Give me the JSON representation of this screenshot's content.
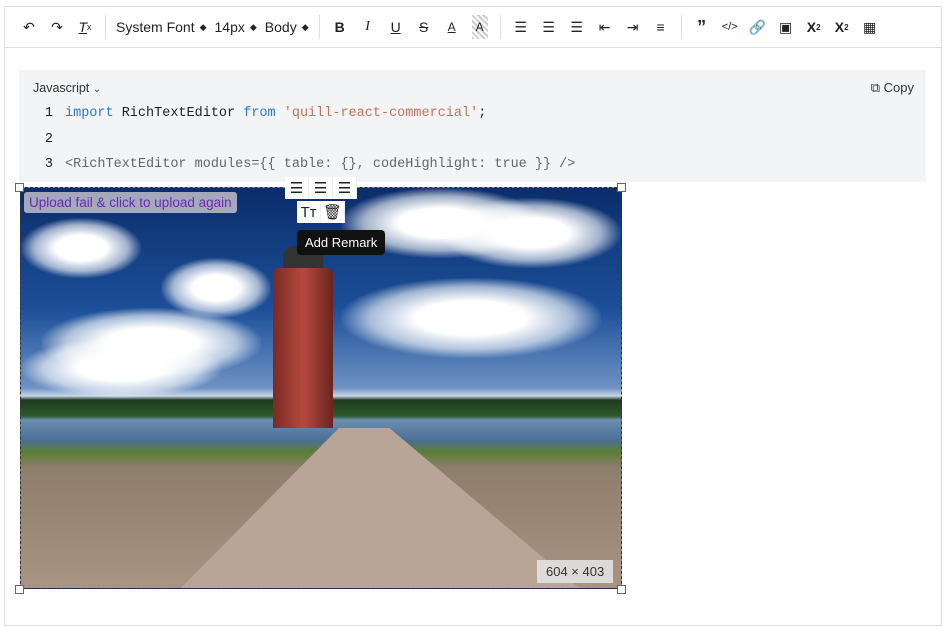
{
  "toolbar": {
    "font": "System Font",
    "size": "14px",
    "heading": "Body"
  },
  "code": {
    "language": "Javascript",
    "copy": "Copy",
    "lines": [
      {
        "n": "1",
        "kw1": "import",
        "t1": " RichTextEditor ",
        "kw2": "from",
        "str": "'quill-react-commercial'",
        "end": ";"
      },
      {
        "n": "2"
      },
      {
        "n": "3",
        "text": "<RichTextEditor modules={{ table: {}, codeHighlight: true }} />"
      }
    ]
  },
  "image": {
    "error": "Upload fail & click to upload again",
    "tooltip": "Add Remark",
    "size": "604 × 403"
  }
}
